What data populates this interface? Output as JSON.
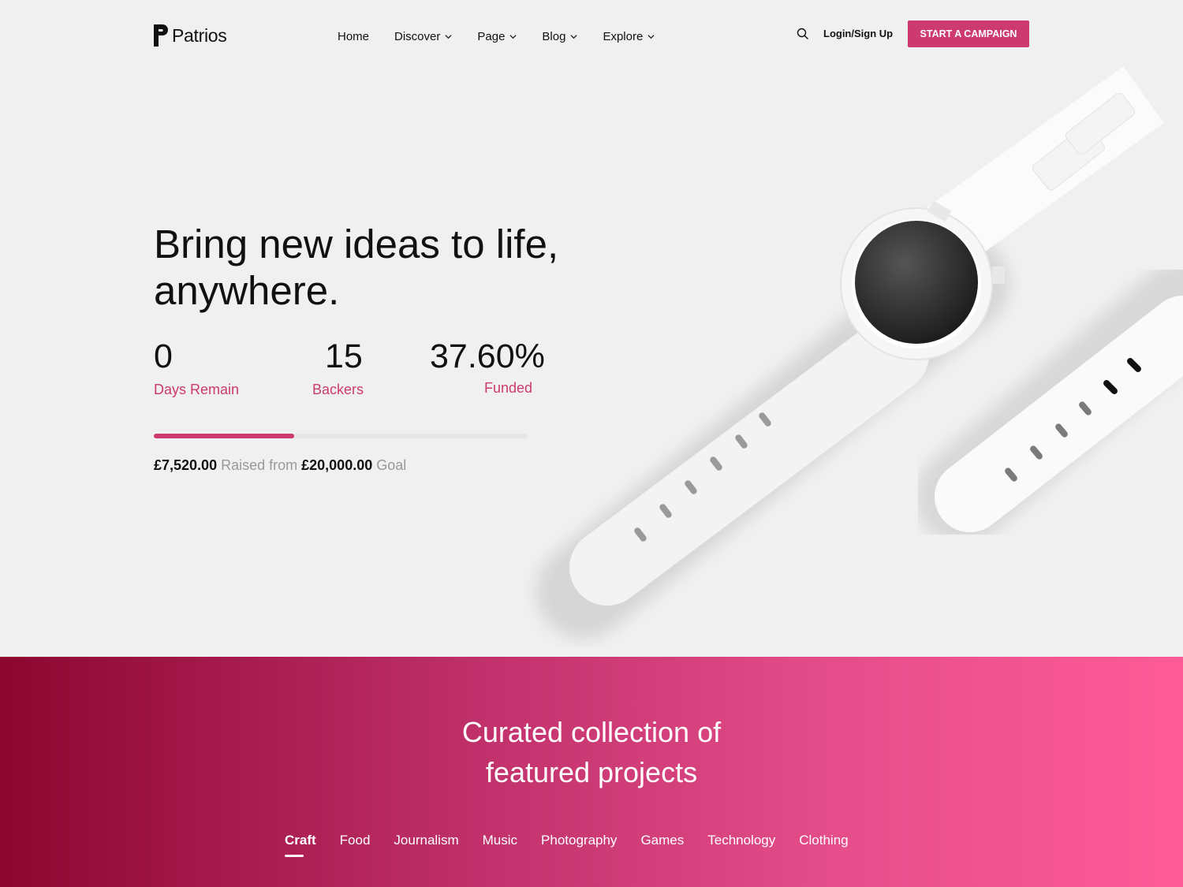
{
  "header": {
    "logo_text": "Patrios",
    "nav": [
      {
        "label": "Home",
        "has_dropdown": false
      },
      {
        "label": "Discover",
        "has_dropdown": true
      },
      {
        "label": "Page",
        "has_dropdown": true
      },
      {
        "label": "Blog",
        "has_dropdown": true
      },
      {
        "label": "Explore",
        "has_dropdown": true
      }
    ],
    "search_icon": "search-icon",
    "login_label": "Login/Sign Up",
    "cta_label": "START A CAMPAIGN"
  },
  "hero": {
    "title": "Bring new ideas to life, anywhere.",
    "stats": [
      {
        "value": "0",
        "label": "Days Remain"
      },
      {
        "value": "15",
        "label": "Backers"
      },
      {
        "value": "37.60%",
        "label": "Funded"
      }
    ],
    "progress_fraction": 0.376,
    "raised_amount": "£7,520.00",
    "raised_text": "Raised from",
    "goal_amount": "£20,000.00",
    "goal_text": "Goal"
  },
  "featured": {
    "title": "Curated collection of featured projects",
    "tabs": [
      "Craft",
      "Food",
      "Journalism",
      "Music",
      "Photography",
      "Games",
      "Technology",
      "Clothing"
    ],
    "active_tab": "Craft"
  },
  "colors": {
    "accent": "#cc3a6f",
    "band_start": "#8c0630",
    "band_end": "#ff5b97"
  }
}
